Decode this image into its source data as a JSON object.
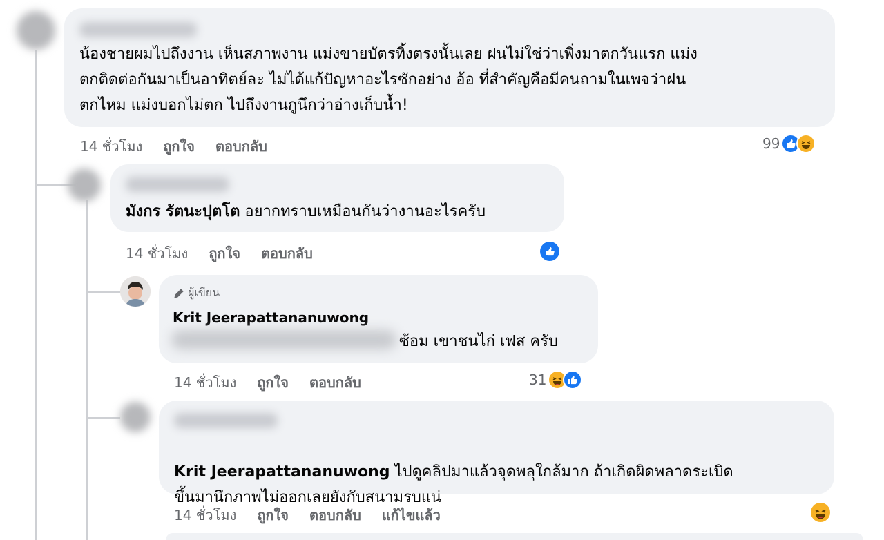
{
  "comments": [
    {
      "body": "น้องชายผมไปถึงงาน เห็นสภาพงาน แม่งขายบัตรทิ้งตรงนั้นเลย ฝนไม่ใช่ว่าเพิ่งมาตกวันแรก แม่ง\nตกติดต่อกันมาเป็นอาทิตย์ละ ไม่ได้แก้ปัญหาอะไรซักอย่าง อ้อ ที่สำคัญคือมีคนถามในเพจว่าฝน\nตกไหม แม่งบอกไม่ตก ไปถึงงานกูนึกว่าอ่างเก็บน้ำ!",
      "time": "14 ชั่วโมง",
      "like": "ถูกใจ",
      "reply": "ตอบกลับ",
      "reaction_count": "99",
      "reaction_icons": [
        "like-icon",
        "haha-icon"
      ]
    },
    {
      "mention": "มังกร รัตนะปุตโต",
      "body": " อยากทราบเหมือนกันว่างานอะไรครับ",
      "time": "14 ชั่วโมง",
      "like": "ถูกใจ",
      "reply": "ตอบกลับ",
      "reaction_icons": [
        "like-icon"
      ]
    },
    {
      "badge": "ผู้เขียน",
      "author": "Krit Jeerapattananuwong",
      "body_visible": "ซ้อม เขาชนไก่ เฟส ครับ",
      "time": "14 ชั่วโมง",
      "like": "ถูกใจ",
      "reply": "ตอบกลับ",
      "reaction_count": "31",
      "reaction_icons": [
        "haha-icon",
        "like-icon"
      ]
    },
    {
      "mention": "Krit Jeerapattananuwong",
      "body_line1": " ไปดูคลิปมาแล้วจุดพลุใกล้มาก ถ้าเกิดผิดพลาดระเบิด",
      "body_line2": "ขึ้นมานึกภาพไม่ออกเลยยังกับสนามรบแน่",
      "time": "14 ชั่วโมง",
      "like": "ถูกใจ",
      "reply": "ตอบกลับ",
      "edited": "แก้ไขแล้ว",
      "reaction_icons": [
        "haha-icon"
      ]
    }
  ],
  "colors": {
    "like_blue": "#1877f2",
    "haha_yellow": "#f7b125",
    "bubble_bg": "#f0f2f5",
    "meta_gray": "#65676b"
  }
}
